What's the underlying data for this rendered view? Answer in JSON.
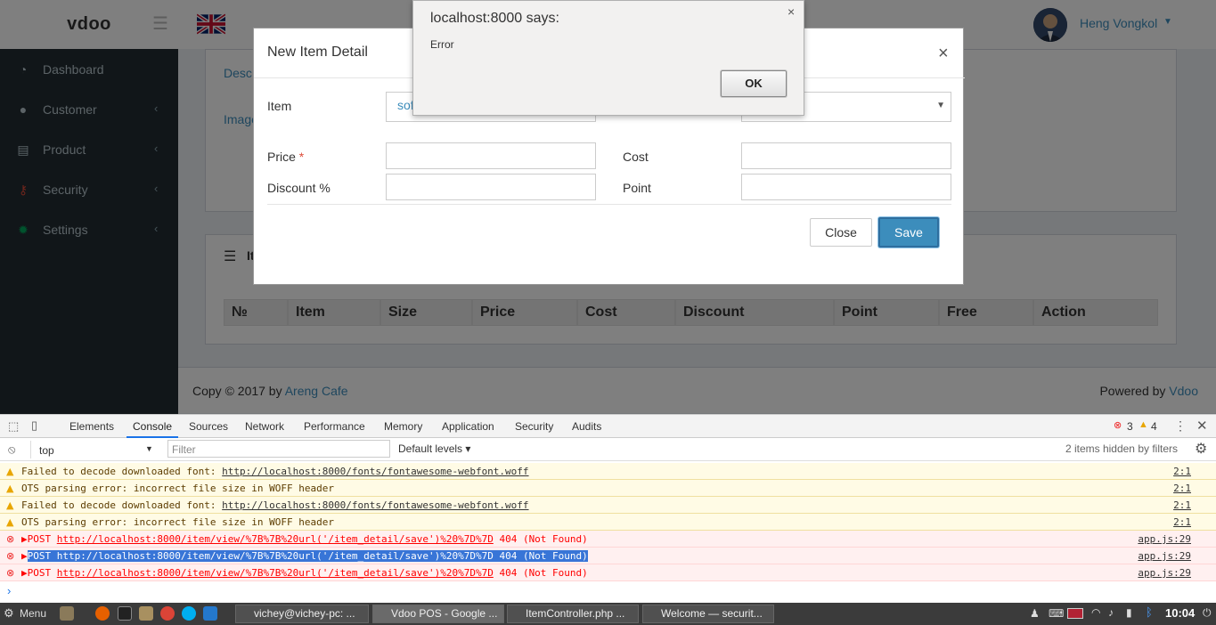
{
  "app": {
    "logo": "vdoo",
    "user_name": "Heng Vongkol"
  },
  "sidebar": {
    "items": [
      {
        "label": "Dashboard",
        "icon": "dashboard-icon"
      },
      {
        "label": "Customer",
        "icon": "users-icon"
      },
      {
        "label": "Product",
        "icon": "basket-icon"
      },
      {
        "label": "Security",
        "icon": "key-icon"
      },
      {
        "label": "Settings",
        "icon": "gear-icon"
      }
    ]
  },
  "background": {
    "desc_label": "Desc",
    "image_label": "Image",
    "box_title_partial": "It",
    "table_headers": [
      "№",
      "Item",
      "Size",
      "Price",
      "Cost",
      "Discount",
      "Point",
      "Free",
      "Action"
    ]
  },
  "footer": {
    "copy": "Copy © 2017 by ",
    "company": "Areng Cafe",
    "powered": "Powered by ",
    "powered_link": "Vdoo"
  },
  "modal": {
    "title": "New Item Detail",
    "close_glyph": "×",
    "item_label": "Item",
    "item_value": "sof",
    "price_label": "Price",
    "required_mark": "*",
    "cost_label": "Cost",
    "discount_label": "Discount %",
    "point_label": "Point",
    "close_button": "Close",
    "save_button": "Save"
  },
  "alert": {
    "title": "localhost:8000 says:",
    "message": "Error",
    "ok": "OK",
    "close_glyph": "×"
  },
  "devtools": {
    "tabs": [
      "Elements",
      "Console",
      "Sources",
      "Network",
      "Performance",
      "Memory",
      "Application",
      "Security",
      "Audits"
    ],
    "active_tab": "Console",
    "error_count": "3",
    "warning_count": "4",
    "context": "top",
    "filter_placeholder": "Filter",
    "levels": "Default levels",
    "hidden_note": "2 items hidden by filters",
    "messages": [
      {
        "type": "warn",
        "prefix": "Failed to decode downloaded font: ",
        "link": "http://localhost:8000/fonts/fontawesome-webfont.woff",
        "suffix": "",
        "source": "2:1"
      },
      {
        "type": "warn",
        "prefix": "OTS parsing error: incorrect file size in WOFF header",
        "link": "",
        "suffix": "",
        "source": "2:1"
      },
      {
        "type": "warn",
        "prefix": "Failed to decode downloaded font: ",
        "link": "http://localhost:8000/fonts/fontawesome-webfont.woff",
        "suffix": "",
        "source": "2:1"
      },
      {
        "type": "warn",
        "prefix": "OTS parsing error: incorrect file size in WOFF header",
        "link": "",
        "suffix": "",
        "source": "2:1"
      },
      {
        "type": "err",
        "prefix": "▶POST ",
        "link": "http://localhost:8000/item/view/%7B%7B%20url('/item_detail/save')%20%7D%7D",
        "suffix": " 404 (Not Found)",
        "source": "app.js:29"
      },
      {
        "type": "err",
        "prefix": "▶POST ",
        "link": "http://localhost:8000/item/view/%7B%7B%20url('/item_detail/save')%20%7D%7D",
        "suffix": " 404 (Not Found)",
        "source": "app.js:29"
      },
      {
        "type": "err",
        "prefix": "▶POST ",
        "link": "http://localhost:8000/item/view/%7B%7B%20url('/item_detail/save')%20%7D%7D",
        "suffix": " 404 (Not Found)",
        "source": "app.js:29"
      }
    ],
    "prompt": "›"
  },
  "taskbar": {
    "menu": "Menu",
    "windows": [
      {
        "label": "vichey@vichey-pc: ..."
      },
      {
        "label": "Vdoo POS - Google ..."
      },
      {
        "label": "ItemController.php ..."
      },
      {
        "label": "Welcome — securit..."
      }
    ],
    "clock": "10:04"
  }
}
